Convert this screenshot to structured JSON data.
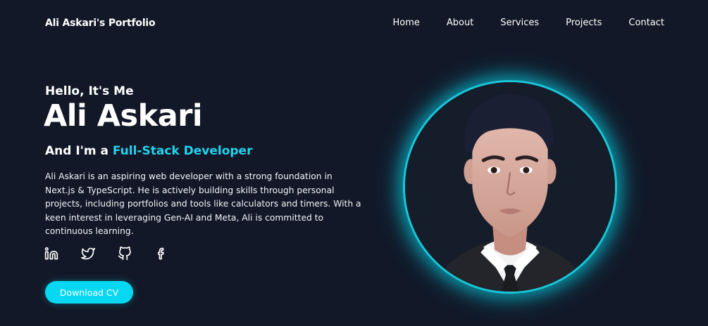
{
  "header": {
    "brand": "Ali Askari's Portfolio",
    "nav": [
      "Home",
      "About",
      "Services",
      "Projects",
      "Contact"
    ]
  },
  "hero": {
    "greeting": "Hello, It's Me",
    "name": "Ali Askari",
    "role_prefix": "And I'm a",
    "role_highlight": "Full-Stack Developer",
    "bio": "Ali Askari is an aspiring web developer with a strong foundation in Next.js & TypeScript. He is actively building skills through personal projects, including portfolios and tools like calculators and timers. With a keen interest in leveraging Gen-AI and Meta, Ali is committed to continuous learning.",
    "cta_label": "Download CV"
  },
  "socials": {
    "icons": [
      "linkedin-icon",
      "twitter-icon",
      "github-icon",
      "facebook-icon"
    ]
  },
  "colors": {
    "background": "#121827",
    "accent": "#22d3ee",
    "button": "#06d8f1",
    "ring": "#19c6d6"
  }
}
